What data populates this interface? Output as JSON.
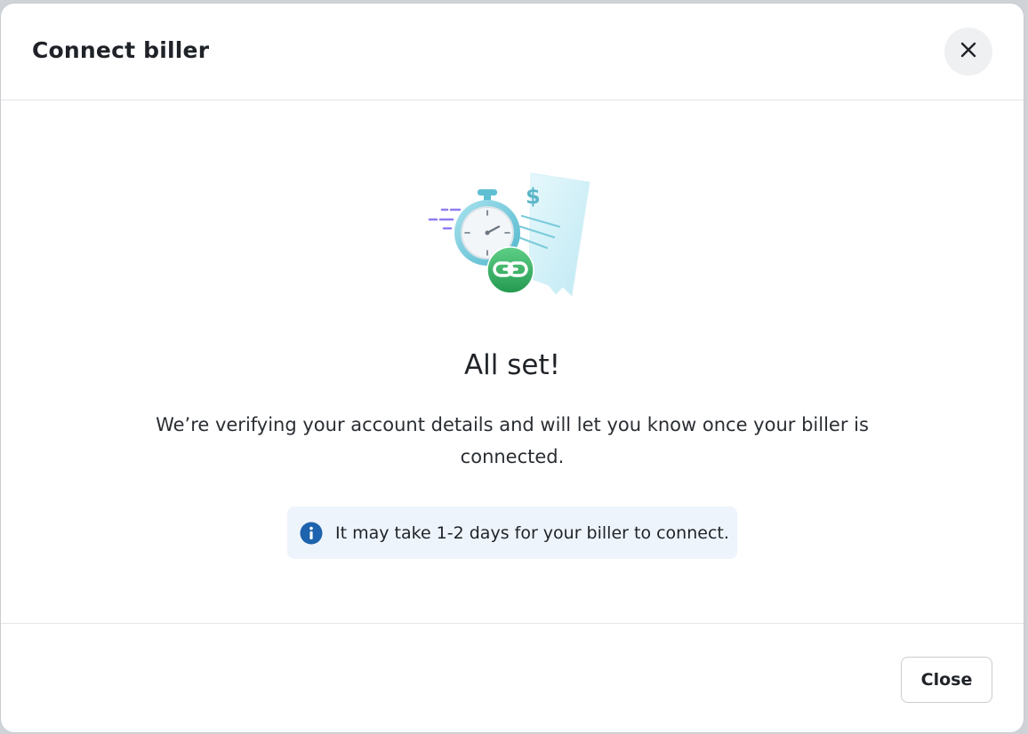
{
  "modal": {
    "title": "Connect biller",
    "close_icon": "close-icon"
  },
  "body": {
    "illustration": "stopwatch-bill-link-illustration",
    "illustration_symbol": "$",
    "headline": "All set!",
    "description": "We’re verifying your account details and will let you know once your biller is connected.",
    "info": {
      "icon": "info-icon",
      "text": "It may take 1-2 days for your biller to connect."
    }
  },
  "footer": {
    "close_label": "Close"
  },
  "colors": {
    "info_icon": "#1d63ad",
    "info_bg": "#eef4fb",
    "link_badge": "#2fae63",
    "text": "#1f2328"
  }
}
